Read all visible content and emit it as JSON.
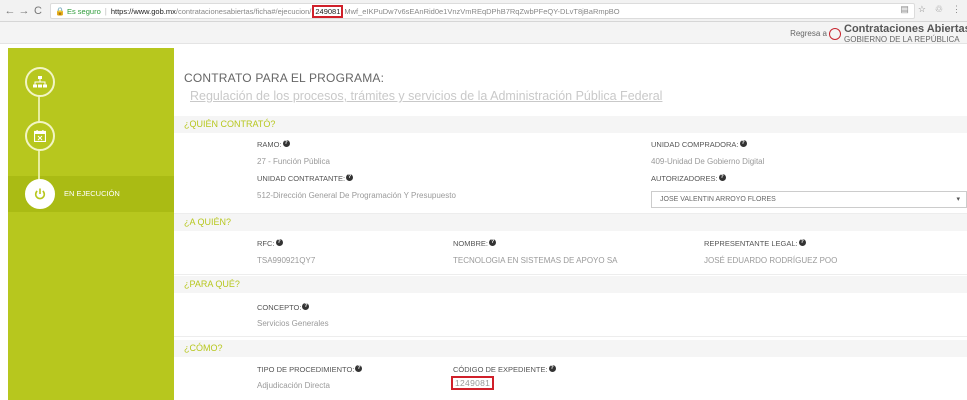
{
  "browser": {
    "secure_label": "Es seguro",
    "url_host": "https://www.gob.mx",
    "url_path": "/contratacionesabiertas/ficha#/ejecucion/",
    "url_highlight": "249081",
    "url_rest": "Mwf_eIKPuDw7v6sEAnRid0e1VnzVmREqDPhB7RqZwbPFeQY-DLvT8jBaRmpBO"
  },
  "header": {
    "back_label": "Regresa a",
    "logo_title": "Contrataciones Abiertas",
    "logo_subtitle": "GOBIERNO DE LA REPÚBLICA"
  },
  "sidebar": {
    "active_label": "EN EJECUCIÓN"
  },
  "contract": {
    "title": "CONTRATO PARA EL PROGRAMA:",
    "program": "Regulación de los procesos, trámites y servicios de la Administración Pública Federal"
  },
  "quien_contrato": {
    "heading": "¿QUIÉN CONTRATÓ?",
    "ramo_label": "RAMO:",
    "ramo_value": "27 - Función Pública",
    "unidad_compradora_label": "UNIDAD COMPRADORA:",
    "unidad_compradora_value": "409-Unidad De Gobierno Digital",
    "unidad_contratante_label": "UNIDAD CONTRATANTE:",
    "unidad_contratante_value": "512-Dirección General De Programación Y Presupuesto",
    "autorizadores_label": "AUTORIZADORES:",
    "autorizadores_value": "JOSE VALENTIN ARROYO FLORES"
  },
  "a_quien": {
    "heading": "¿A QUIÉN?",
    "rfc_label": "RFC:",
    "rfc_value": "TSA990921QY7",
    "nombre_label": "NOMBRE:",
    "nombre_value": "TECNOLOGIA EN SISTEMAS DE APOYO SA",
    "representante_label": "REPRESENTANTE LEGAL:",
    "representante_value": "JOSÉ EDUARDO RODRÍGUEZ POO"
  },
  "para_que": {
    "heading": "¿PARA QUÉ?",
    "concepto_label": "CONCEPTO:",
    "concepto_value": "Servicios Generales"
  },
  "como": {
    "heading": "¿CÓMO?",
    "tipo_label": "TIPO DE PROCEDIMIENTO:",
    "tipo_value": "Adjudicación Directa",
    "codigo_label": "CÓDIGO DE EXPEDIENTE:",
    "codigo_value": "1249081"
  },
  "colors": {
    "accent": "#b7c71e",
    "highlight_border": "#d0202a"
  },
  "icons": [
    "back-arrow-icon",
    "forward-arrow-icon",
    "reload-icon",
    "lock-icon",
    "help-icon",
    "sitemap-icon",
    "calendar-icon",
    "power-icon",
    "chevron-down-icon"
  ]
}
